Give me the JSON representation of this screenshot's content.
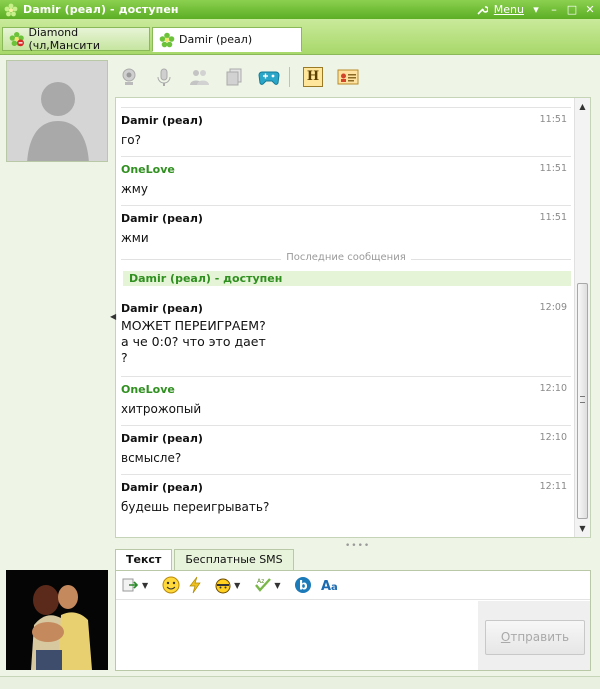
{
  "window": {
    "title": "Damir (реал) - доступен",
    "menu_label": "Menu",
    "accent": "#5cad25"
  },
  "tabs": [
    {
      "label": "Diamond (чл,Мансити",
      "active": false
    },
    {
      "label": "Damir (реал)",
      "active": true
    }
  ],
  "toolbar": {
    "icons": [
      "webcam-icon",
      "microphone-icon",
      "conference-icon",
      "files-icon",
      "gamepad-icon",
      "history-icon",
      "contact-card-icon"
    ],
    "history_letter": "H"
  },
  "chat": {
    "messages": [
      {
        "sender": "Damir (реал)",
        "time": "11:51",
        "text": "го?",
        "own": false
      },
      {
        "sender": "OneLove",
        "time": "11:51",
        "text": "жму",
        "own": true
      },
      {
        "sender": "Damir (реал)",
        "time": "11:51",
        "text": "жми",
        "own": false
      },
      {
        "sender": "Damir (реал)",
        "time": "12:09",
        "lines": [
          "МОЖЕТ ПЕРЕИГРАЕМ?",
          "а че 0:0? что это дает",
          "?"
        ],
        "own": false
      },
      {
        "sender": "OneLove",
        "time": "12:10",
        "text": "хитрожопый",
        "own": true
      },
      {
        "sender": "Damir (реал)",
        "time": "12:10",
        "text": "всмысле?",
        "own": false
      },
      {
        "sender": "Damir (реал)",
        "time": "12:11",
        "text": "будешь переигрывать?",
        "own": false
      }
    ],
    "last_messages_label": "Последние сообщения",
    "status_line": "Damir (реал) - доступен"
  },
  "input": {
    "tabs": [
      "Текст",
      "Бесплатные SMS"
    ],
    "send_label_u": "О",
    "send_label_rest": "тправить"
  }
}
